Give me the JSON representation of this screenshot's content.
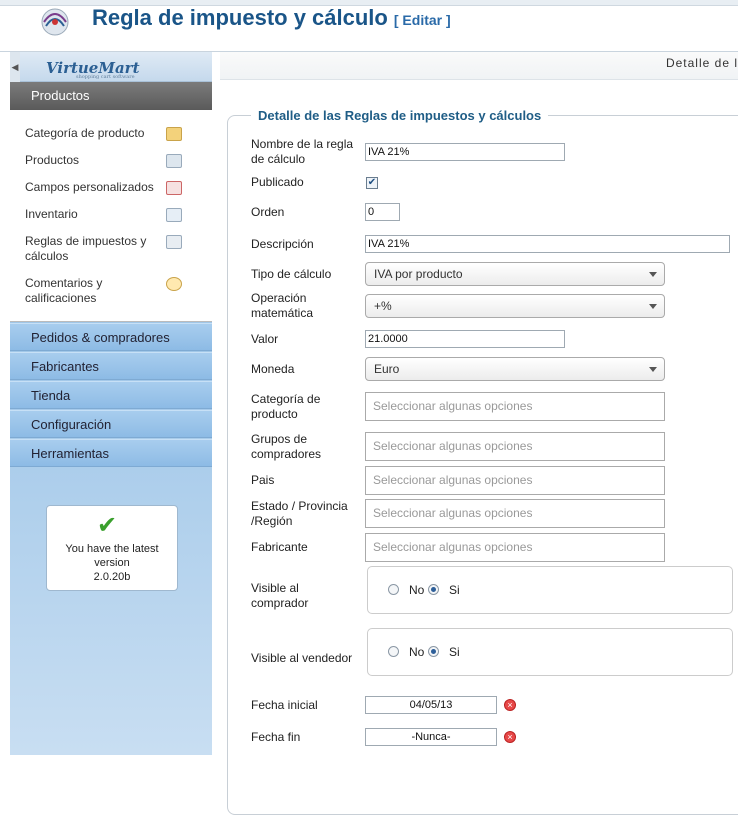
{
  "header": {
    "title": "Regla de impuesto y cálculo",
    "edit_label": "[ Editar ]"
  },
  "sidebar": {
    "brand": "VirtueMart",
    "brand_tagline": "shopping cart software",
    "section": "Productos",
    "sub_items": [
      {
        "label": "Categoría de producto",
        "icon": "folder-icon"
      },
      {
        "label": "Productos",
        "icon": "camera-icon"
      },
      {
        "label": "Campos personalizados",
        "icon": "custom-fields-icon"
      },
      {
        "label": "Inventario",
        "icon": "inventory-icon"
      },
      {
        "label": "Reglas de impuestos y cálculos",
        "icon": "calculator-icon"
      },
      {
        "label": "Comentarios y calificaciones",
        "icon": "comment-bubble-icon"
      }
    ],
    "menu": [
      "Pedidos & compradores",
      "Fabricantes",
      "Tienda",
      "Configuración",
      "Herramientas"
    ],
    "version": {
      "line1": "You have the latest version",
      "line2": "2.0.20b"
    }
  },
  "toolbar": {
    "tab": "Detalle de l"
  },
  "form": {
    "legend": "Detalle de las Reglas de impuestos y cálculos",
    "nombre": {
      "label": "Nombre de la regla de cálculo",
      "value": "IVA 21%"
    },
    "publicado": {
      "label": "Publicado",
      "checked": true
    },
    "orden": {
      "label": "Orden",
      "value": "0"
    },
    "descripcion": {
      "label": "Descripción",
      "value": "IVA 21%"
    },
    "tipo": {
      "label": "Tipo de cálculo",
      "value": "IVA por producto"
    },
    "operacion": {
      "label": "Operación matemática",
      "value": "+%"
    },
    "valor": {
      "label": "Valor",
      "value": "21.0000"
    },
    "moneda": {
      "label": "Moneda",
      "value": "Euro"
    },
    "categoria": {
      "label": "Categoría de producto",
      "placeholder": "Seleccionar algunas opciones"
    },
    "grupos": {
      "label": "Grupos de compradores",
      "placeholder": "Seleccionar algunas opciones"
    },
    "pais": {
      "label": "Pais",
      "placeholder": "Seleccionar algunas opciones"
    },
    "estado": {
      "label": "Estado / Provincia /Región",
      "placeholder": "Seleccionar algunas opciones"
    },
    "fabricante": {
      "label": "Fabricante",
      "placeholder": "Seleccionar algunas opciones"
    },
    "visible_comprador": {
      "label": "Visible al comprador",
      "no": "No",
      "si": "Si",
      "selected": "Si"
    },
    "visible_vendedor": {
      "label": "Visible al vendedor",
      "no": "No",
      "si": "Si",
      "selected": "Si"
    },
    "fecha_inicial": {
      "label": "Fecha inicial",
      "value": "04/05/13"
    },
    "fecha_fin": {
      "label": "Fecha fin",
      "value": "-Nunca-"
    }
  }
}
